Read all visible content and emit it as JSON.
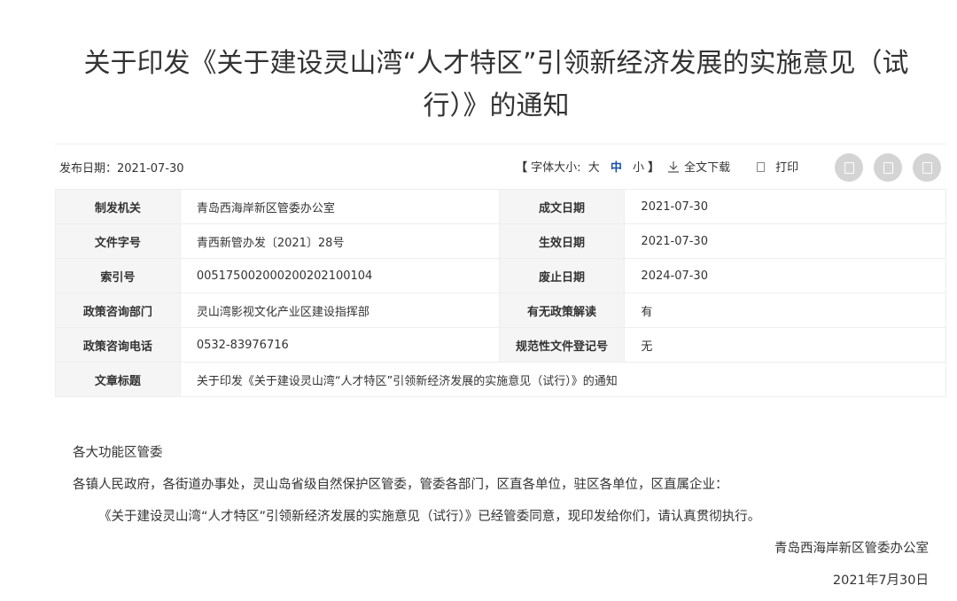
{
  "title": {
    "line1": "关于印发《关于建设灵山湾“人才特区”引领新经济发展的实施意见（试",
    "line2": "行）》的通知"
  },
  "meta": {
    "pub_date": "发布日期：2021-07-30",
    "bracket_open": "【",
    "font_size_label": "字体大小:",
    "font_large": "大",
    "font_medium": "中",
    "font_small": "小",
    "bracket_close": "】",
    "download_label": "全文下载",
    "print_label": "打印",
    "share_icons": [
      "share-icon-1",
      "share-icon-2",
      "share-icon-3"
    ],
    "accent_color": "#1a4ea6"
  },
  "info_table": {
    "rows": [
      {
        "l1": "制发机关",
        "v1": "青岛西海岸新区管委办公室",
        "l2": "成文日期",
        "v2": "2021-07-30"
      },
      {
        "l1": "文件字号",
        "v1": "青西新管办发〔2021〕28号",
        "l2": "生效日期",
        "v2": "2021-07-30"
      },
      {
        "l1": "索引号",
        "v1": "00517500200020020210 0104",
        "l2": "废止日期",
        "v2": "2024-07-30"
      },
      {
        "l1": "政策咨询部门",
        "v1": "灵山湾影视文化产业区建设指挥部",
        "l2": "有无政策解读",
        "v2": "有"
      },
      {
        "l1": "政策咨询电话",
        "v1": "0532-83976716",
        "l2": "规范性文件登记号",
        "v2": "无"
      }
    ],
    "title_row": {
      "label": "文章标题",
      "value": "关于印发《关于建设灵山湾“人才特区”引领新经济发展的实施意见（试行）》的通知"
    }
  },
  "body": {
    "p1": "各大功能区管委",
    "p2": "各镇人民政府，各街道办事处，灵山岛省级自然保护区管委，管委各部门，区直各单位，驻区各单位，区直属企业：",
    "p3": "《关于建设灵山湾“人才特区”引领新经济发展的实施意见（试行）》已经管委同意，现印发给你们，请认真贯彻执行。",
    "signature": "青岛西海岸新区管委办公室",
    "date": "2021年7月30日"
  }
}
